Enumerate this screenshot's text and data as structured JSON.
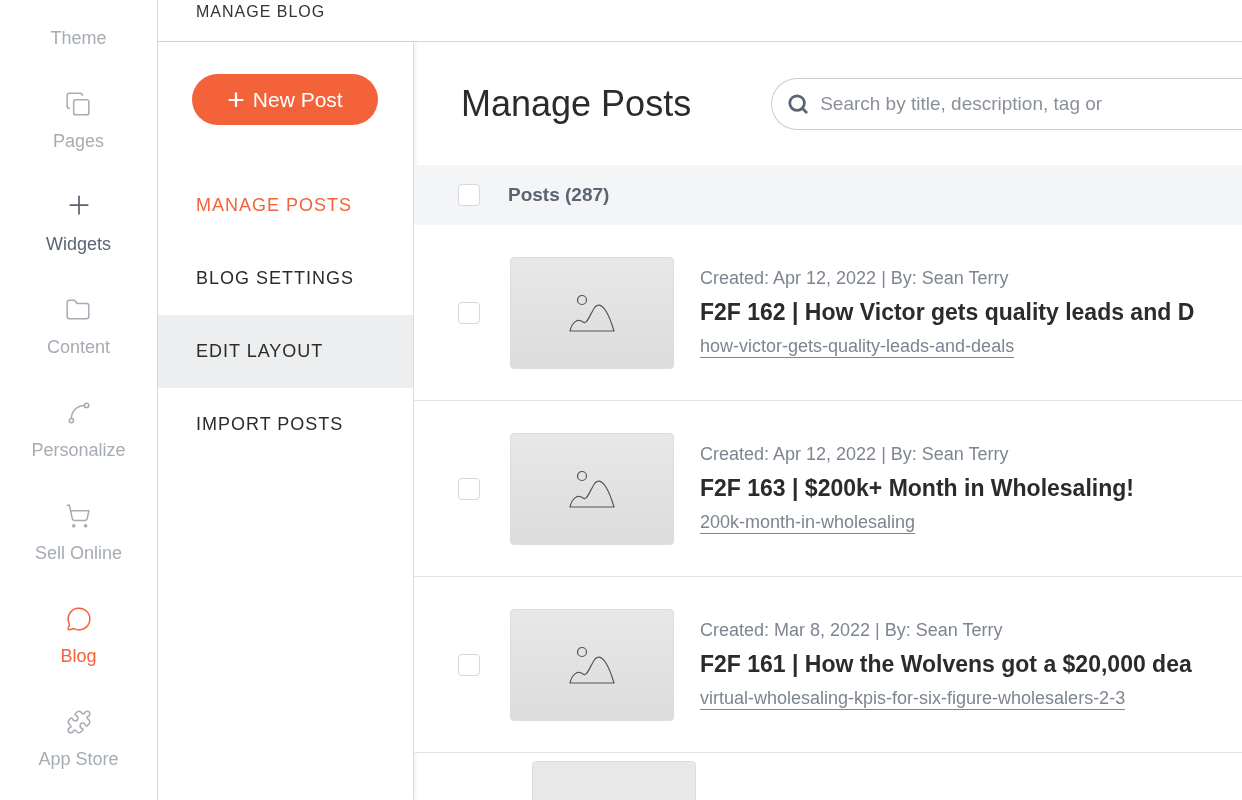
{
  "rail": [
    {
      "label": "Theme",
      "selected": false,
      "hovered": false
    },
    {
      "label": "Pages",
      "selected": false,
      "hovered": false
    },
    {
      "label": "Widgets",
      "selected": false,
      "hovered": true
    },
    {
      "label": "Content",
      "selected": false,
      "hovered": false
    },
    {
      "label": "Personalize",
      "selected": false,
      "hovered": false
    },
    {
      "label": "Sell Online",
      "selected": false,
      "hovered": false
    },
    {
      "label": "Blog",
      "selected": true,
      "hovered": false
    },
    {
      "label": "App Store",
      "selected": false,
      "hovered": false
    }
  ],
  "header": {
    "title": "MANAGE BLOG"
  },
  "new_post_button": {
    "icon": "+",
    "label": "New Post"
  },
  "submenu": [
    {
      "label": "MANAGE POSTS",
      "selected": true,
      "hovered": false
    },
    {
      "label": "BLOG SETTINGS",
      "selected": false,
      "hovered": false
    },
    {
      "label": "EDIT LAYOUT",
      "selected": false,
      "hovered": true
    },
    {
      "label": "IMPORT POSTS",
      "selected": false,
      "hovered": false
    }
  ],
  "page_title": "Manage Posts",
  "search": {
    "placeholder": "Search by title, description, tag or"
  },
  "table": {
    "header": {
      "label": "Posts (287)",
      "checked": false
    },
    "rows": [
      {
        "checked": false,
        "meta": "Created: Apr 12, 2022 | By: Sean Terry",
        "title": "F2F 162 | How Victor gets quality leads and D",
        "slug": "how-victor-gets-quality-leads-and-deals"
      },
      {
        "checked": false,
        "meta": "Created: Apr 12, 2022 | By: Sean Terry",
        "title": "F2F 163 | $200k+ Month in Wholesaling!",
        "slug": "200k-month-in-wholesaling"
      },
      {
        "checked": false,
        "meta": "Created: Mar 8, 2022 | By: Sean Terry",
        "title": "F2F 161 | How the Wolvens got a $20,000 dea",
        "slug": "virtual-wholesaling-kpis-for-six-figure-wholesalers-2-3"
      },
      {
        "kind": "partial"
      }
    ]
  }
}
